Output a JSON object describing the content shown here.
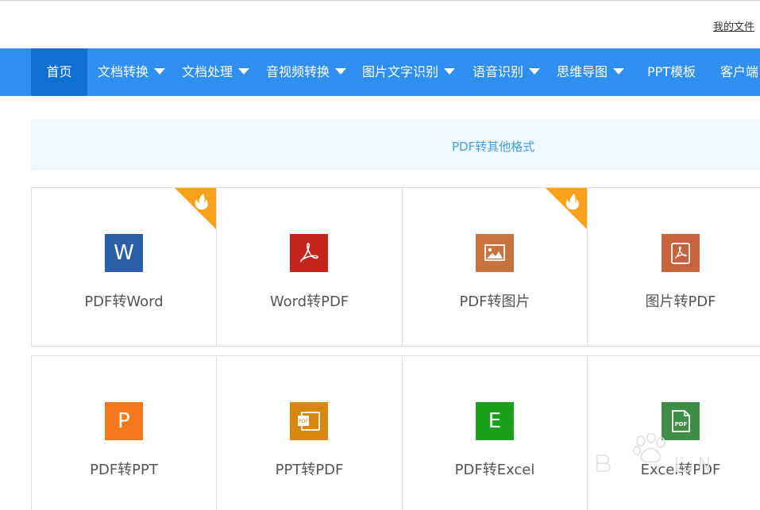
{
  "header": {
    "my_files": "我的文件"
  },
  "nav": {
    "items": [
      {
        "label": "首页",
        "dropdown": false,
        "active": true
      },
      {
        "label": "文档转换",
        "dropdown": true
      },
      {
        "label": "文档处理",
        "dropdown": true
      },
      {
        "label": "音视频转换",
        "dropdown": true
      },
      {
        "label": "图片文字识别",
        "dropdown": true
      },
      {
        "label": "语音识别",
        "dropdown": true
      },
      {
        "label": "思维导图",
        "dropdown": true
      },
      {
        "label": "PPT模板",
        "dropdown": false
      },
      {
        "label": "客户端",
        "dropdown": false
      }
    ]
  },
  "section": {
    "title": "PDF转其他格式"
  },
  "tools": [
    {
      "label": "PDF转Word",
      "icon": "word-icon",
      "icon_text": "W",
      "color": "#2b5fa8",
      "hot": true
    },
    {
      "label": "Word转PDF",
      "icon": "pdf-acrobat-icon",
      "color": "#c4241a",
      "hot": false
    },
    {
      "label": "PDF转图片",
      "icon": "image-icon",
      "color": "#c8733e",
      "hot": true
    },
    {
      "label": "图片转PDF",
      "icon": "pdf-doc-icon",
      "color": "#c8633e",
      "hot": false
    },
    {
      "label": "PDF转PPT",
      "icon": "powerpoint-icon",
      "icon_text": "P",
      "color": "#f5771e",
      "hot": false
    },
    {
      "label": "PPT转PDF",
      "icon": "ppt-pdf-icon",
      "icon_text": "PDF",
      "color": "#d9870c",
      "hot": false
    },
    {
      "label": "PDF转Excel",
      "icon": "excel-icon",
      "icon_text": "E",
      "color": "#1aa01a",
      "hot": false
    },
    {
      "label": "Excel转PDF",
      "icon": "pdf-file-icon",
      "icon_text": "PDF",
      "color": "#3e8f45",
      "hot": false
    }
  ],
  "colors": {
    "nav_bg": "#2f8ff0",
    "nav_active": "#0f6fd3",
    "section_bg": "#f0f7fd",
    "section_text": "#3fa0dd",
    "hot_badge": "#f7a21a"
  }
}
